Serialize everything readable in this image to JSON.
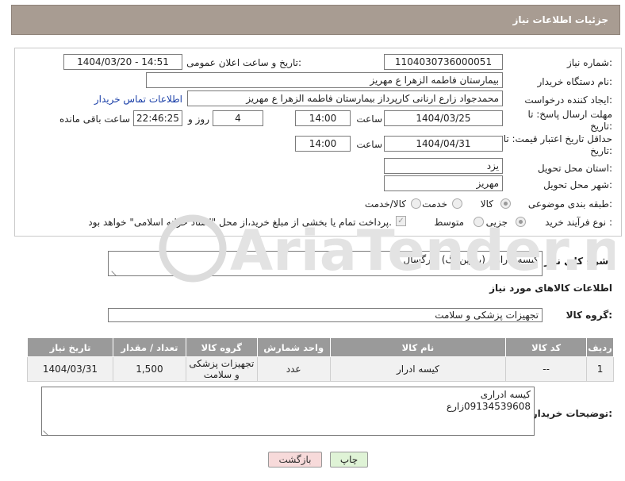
{
  "header": {
    "title": "جزئیات اطلاعات نیاز"
  },
  "form": {
    "need_number_label": "شماره نیاز:",
    "need_number": "1104030736000051",
    "announce_label": "تاریخ و ساعت اعلان عمومی:",
    "announce_value": "1404/03/20 - 14:51",
    "buyer_org_label": "نام دستگاه خریدار:",
    "buyer_org": "بیمارستان فاطمه الزهرا ع  مهریز",
    "creator_label": "ایجاد کننده درخواست:",
    "creator": "محمدجواد زارع ارنانی کارپرداز بیمارستان فاطمه الزهرا ع  مهریز",
    "buyer_contact_link": "اطلاعات تماس خریدار",
    "reply_deadline_label": "مهلت ارسال پاسخ: تا تاریخ:",
    "reply_date": "1404/03/25",
    "time_label": "ساعت",
    "reply_time": "14:00",
    "days_value": "4",
    "days_label": "روز و",
    "remaining_value": "22:46:25",
    "remaining_label": "ساعت باقی مانده",
    "price_validity_label": "حداقل تاریخ اعتبار قیمت: تا تاریخ:",
    "price_date": "1404/04/31",
    "price_time": "14:00",
    "province_label": "استان محل تحویل:",
    "province": "یزد",
    "city_label": "شهر محل تحویل:",
    "city": "مهریز",
    "category_label": "طبقه بندی موضوعی:",
    "category_options": [
      "کالا",
      "خدمت",
      "کالا/خدمت"
    ],
    "process_label": "نوع فرآیند خرید :",
    "process_options": [
      "جزیی",
      "متوسط"
    ],
    "payment_note": "پرداخت تمام یا بخشی از مبلغ خرید،از محل \"اسناد خزانه اسلامی\" خواهد بود."
  },
  "summary": {
    "label": "شرح کلی نیاز:",
    "value": "کیسه ادراری (یورین بگ) بزرگسال"
  },
  "goods": {
    "section_title": "اطلاعات کالاهای مورد نیاز",
    "group_label": "گروه کالا:",
    "group_value": "تجهیزات پزشکی و سلامت"
  },
  "table": {
    "headers": [
      "ردیف",
      "کد کالا",
      "نام کالا",
      "واحد شمارش",
      "گروه کالا",
      "تعداد / مقدار",
      "تاریخ نیاز"
    ],
    "rows": [
      [
        "1",
        "--",
        "کیسه ادرار",
        "عدد",
        "تجهیزات پزشکی و سلامت",
        "1,500",
        "1404/03/31"
      ]
    ]
  },
  "buyer_notes": {
    "label": "توضیحات خریدار:",
    "line1": "کیسه ادراری",
    "line2": "09134539608زارع"
  },
  "buttons": {
    "print": "چاپ",
    "back": "بازگشت"
  },
  "watermark": {
    "text": "AriaTender.neT"
  },
  "colors": {
    "title_bar": "#a89c92",
    "table_header": "#9a9a9a",
    "link": "#1a3fa8",
    "print_btn": "#dff3d6",
    "back_btn": "#f7dada"
  }
}
